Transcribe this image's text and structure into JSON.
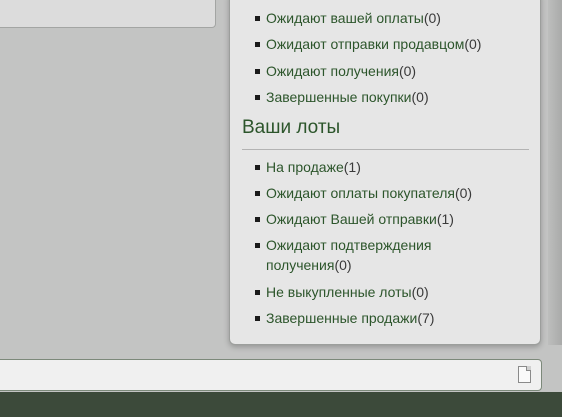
{
  "purchases": {
    "items": [
      {
        "label": "Ожидают вашей оплаты",
        "count": "(0)"
      },
      {
        "label": "Ожидают отправки продавцом",
        "count": "(0)"
      },
      {
        "label": "Ожидают получения",
        "count": "(0)"
      },
      {
        "label": "Завершенные покупки",
        "count": "(0)"
      }
    ]
  },
  "your_lots": {
    "title": "Ваши лоты",
    "items": [
      {
        "label": "На продаже",
        "count": "(1)"
      },
      {
        "label": "Ожидают оплаты покупателя",
        "count": "(0)"
      },
      {
        "label": "Ожидают Вашей отправки",
        "count": "(1)"
      },
      {
        "label": "Ожидают подтверждения",
        "label2": "получения",
        "count": "(0)"
      },
      {
        "label": "Не выкупленные лоты",
        "count": "(0)"
      },
      {
        "label": "Завершенные продажи",
        "count": "(7)"
      }
    ]
  },
  "bottom_bar": {
    "icon": "document-icon"
  },
  "colors": {
    "link": "#2c552b",
    "panel": "#e6e6e6",
    "background": "#c3c4c3"
  }
}
